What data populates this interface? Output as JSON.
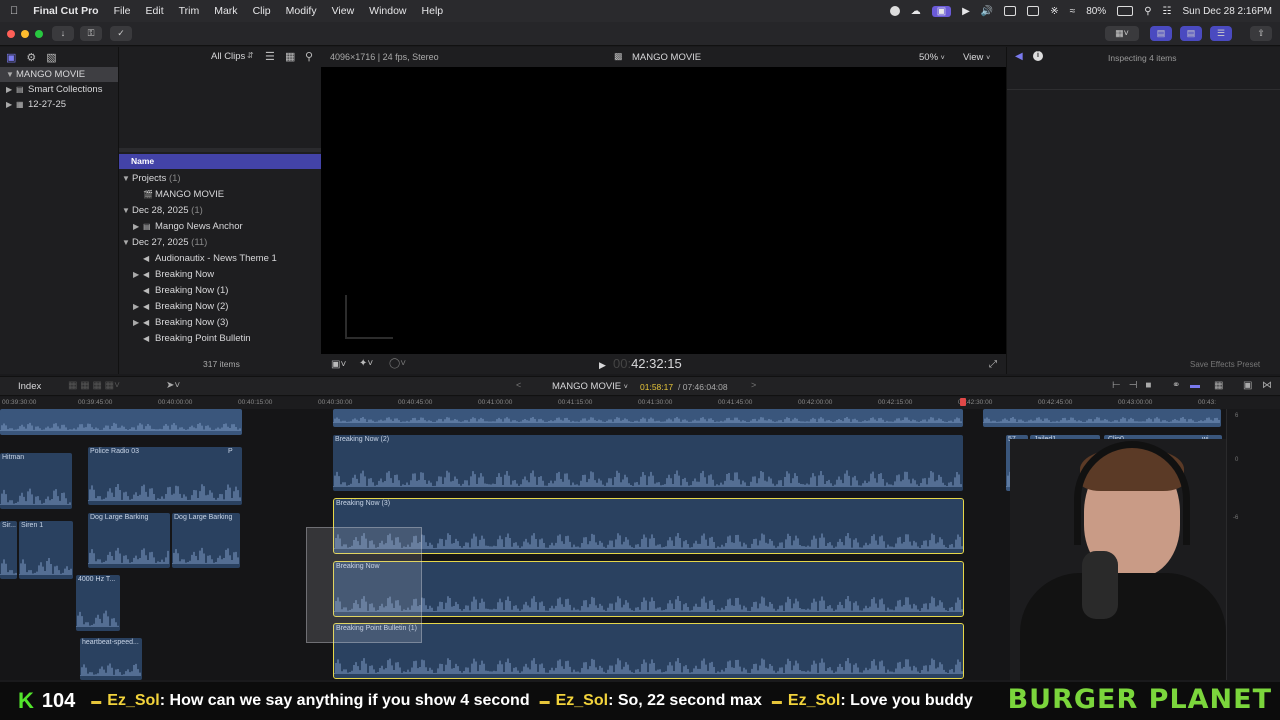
{
  "menubar": {
    "app": "Final Cut Pro",
    "items": [
      "File",
      "Edit",
      "Trim",
      "Mark",
      "Clip",
      "Modify",
      "View",
      "Window",
      "Help"
    ],
    "battery": "80%",
    "datetime": "Sun Dec 28  2:16PM"
  },
  "libraries": {
    "items": [
      "MANGO MOVIE",
      "Smart Collections",
      "12-27-25"
    ]
  },
  "browser": {
    "filter": "All Clips",
    "column_header": "Name",
    "rows": [
      {
        "label": "Projects",
        "count": "(1)",
        "kind": "group"
      },
      {
        "label": "MANGO MOVIE",
        "kind": "project"
      },
      {
        "label": "Dec 28, 2025",
        "count": "(1)",
        "kind": "group"
      },
      {
        "label": "Mango News Anchor",
        "kind": "clip"
      },
      {
        "label": "Dec 27, 2025",
        "count": "(11)",
        "kind": "group"
      },
      {
        "label": "Audionautix - News Theme 1",
        "kind": "audio"
      },
      {
        "label": "Breaking Now",
        "kind": "audio"
      },
      {
        "label": "Breaking Now (1)",
        "kind": "audio"
      },
      {
        "label": "Breaking Now (2)",
        "kind": "audio"
      },
      {
        "label": "Breaking Now (3)",
        "kind": "audio"
      },
      {
        "label": "Breaking Point Bulletin",
        "kind": "audio"
      }
    ],
    "item_count": "317 items"
  },
  "viewer": {
    "format": "4096×1716 | 24 fps, Stereo",
    "title": "MANGO MOVIE",
    "zoom": "50%",
    "view_menu": "View",
    "timecode": "42:32:15"
  },
  "inspector": {
    "status": "Inspecting 4 items",
    "save_preset": "Save Effects Preset"
  },
  "timeline": {
    "index_label": "Index",
    "project": "MANGO MOVIE",
    "position": "01:58:17",
    "duration": "/ 07:46:04:08",
    "ruler": [
      "00:39:30:00",
      "00:39:45:00",
      "00:40:00:00",
      "00:40:15:00",
      "00:40:30:00",
      "00:40:45:00",
      "00:41:00:00",
      "00:41:15:00",
      "00:41:30:00",
      "00:41:45:00",
      "00:42:00:00",
      "00:42:15:00",
      "00:42:30:00",
      "00:42:45:00",
      "00:43:00:00",
      "00:43:"
    ],
    "clips": {
      "hitman": "Hitman",
      "police": "Police Radio 03",
      "police_end": "P",
      "siren_a": "Sir...",
      "siren": "Siren 1",
      "dog1": "Dog Large Barking",
      "dog2": "Dog Large Barking",
      "hz": "4000 Hz T...",
      "heartbeat": "heartbeat-speed...",
      "bn2": "Breaking Now (2)",
      "bn3": "Breaking Now (3)",
      "bn": "Breaking Now",
      "bpb": "Breaking Point Bulletin (1)",
      "jailed": "Jailed1",
      "clip0": "Clip0",
      "c57": "57",
      "wi": "wi"
    },
    "meter": [
      "6",
      "0",
      "-6"
    ]
  },
  "chat": {
    "count": "104",
    "messages": [
      {
        "user": "Ez_Sol",
        "text": ": How can we say anything if you show 4 second"
      },
      {
        "user": "Ez_Sol",
        "text": ": So, 22 second max"
      },
      {
        "user": "Ez_Sol",
        "text": ": Love you buddy"
      }
    ],
    "sponsor": "BURGER PLANET"
  },
  "colors": {
    "accent": "#5a5ad6",
    "clip": "#2a4160",
    "selection": "#e6d74a",
    "chat_user": "#f2d33c",
    "sponsor": "#7bd63c"
  }
}
